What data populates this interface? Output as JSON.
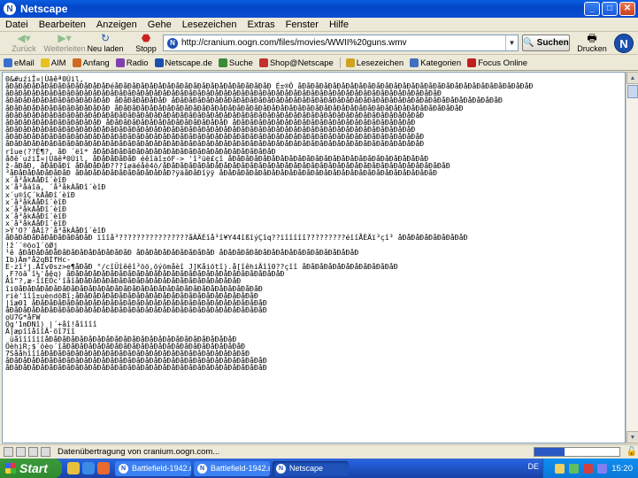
{
  "window": {
    "title": "Netscape"
  },
  "menu": [
    "Datei",
    "Bearbeiten",
    "Anzeigen",
    "Gehe",
    "Lesezeichen",
    "Extras",
    "Fenster",
    "Hilfe"
  ],
  "nav": {
    "back": "Zurück",
    "forward": "Weiterleiten",
    "reload": "Neu laden",
    "stop": "Stopp",
    "url": "http://cranium.oogn.com/files/movies/WWII%20guns.wmv",
    "search": "Suchen",
    "print": "Drucken"
  },
  "personal_toolbar": [
    {
      "label": "eMail",
      "color": "#3a6fd0"
    },
    {
      "label": "AIM",
      "color": "#e8c020"
    },
    {
      "label": "Anfang",
      "color": "#d06a20"
    },
    {
      "label": "Radio",
      "color": "#8040b0"
    },
    {
      "label": "Netscape.de",
      "color": "#1b4fae"
    },
    {
      "label": "Suche",
      "color": "#3a8a3a"
    },
    {
      "label": "Shop@Netscape",
      "color": "#c23030"
    },
    {
      "label": "Lesezeichen",
      "color": "#d0a020"
    },
    {
      "label": "Kategorien",
      "color": "#4070c0"
    },
    {
      "label": "Focus Online",
      "color": "#c02020"
    }
  ],
  "content_lines": [
    "0&#uźiÎ¤|Ùãêª0Ùil,",
    "åÐåÐåÐåÐåÐåÐåÐåÐåÐåÐåÐåÐéåÐåÐåÐåÐåÐåÐåÐåÐåÐåÐåÐåÐåÐåÐåÐåÐåÐåÐ É±®Ô åÐåÐåÐåÐåÐåÐåÐåÐåÐåÐåÐåÐåÐåÐåÐåÐåÐåÐåÐåÐåÐåÐåÐåÐåÐåÐåÐ",
    "åÐåÐåÐåÐåÐåÐåÐåÐåÐåÐåÐåÐåÐåÐåÐåÐåÐåÐåÐåÐåÐåÐåÐåÐåÐåÐåÐåÐåÐåÐåÐåÐåÐåÐåÐåÐåÐåÐåÐåÐåÐåÐåÐåÐåÐåÐåÐåÐåÐåÐ",
    "åÐåÐåÐåÐåÐåÐåÐåÐåÐåÐåÐåÐ åÐåÐåÐåÐåÐåÐ åÐåÐåÐåÐåÐåÐåÐåÐåÐåÐåÐåÐåÐåÐåÐåÐåÐåÐåÐåÐåÐåÐåÐåÐåÐåÐåÐåÐåÐåÐåÐåÐåÐåÐåÐåÐåÐåÐ",
    "åÐåÐåÐåÐåÐåÐåÐåÐåÐåÐåÐåÐ åÐåÐåÐåÐåÐåÐåÐåÐåÐåÐåÐåÐåÐåÐåÐåÐåÐåÐåÐåÐåÐåÐåÐåÐåÐåÐåÐåÐåÐåÐåÐåÐåÐåÐåÐåÐåÐåÐåÐåÐ",
    "åÐåÐåÐåÐåÐåÐåÐåÐåÐåÐåÐåÐåÐåÐåÐåÐåÐåÐåÐåÐåÐåÐåÐåÐåÐåÐåÐåÐåÐåÐåÐåÐåÐåÐåÐåÐåÐåÐåÐåÐåÐåÐåÐåÐåÐåÐåÐåÐ",
    "åÐåÐåÐåÐåÐåÐåÐåÐåÐåÐåÐ åÐåÐåÐåÐåÐåÐåÐåÐåÐåÐåÐåÐåÐåÐ åÐåÐåÐåÐåÐåÐåÐåÐåÐåÐåÐåÐåÐåÐåÐåÐåÐåÐåÐåÐåÐ",
    "åÐåÐåÐåÐåÐåÐåÐåÐåÐåÐåÐåÐåÐåÐåÐåÐåÐåÐåÐåÐåÐåÐåÐåÐåÐåÐåÐåÐåÐåÐåÐåÐåÐåÐåÐåÐåÐåÐåÐåÐåÐåÐåÐåÐåÐåÐåÐ",
    "åÐåÐåÐåÐåÐåÐåÐåÐåÐåÐåÐåÐåÐåÐåÐåÐåÐåÐåÐåÐåÐåÐåÐåÐåÐåÐåÐåÐåÐåÐåÐåÐåÐåÐåÐåÐåÐåÐåÐåÐåÐåÐåÐåÐåÐåÐåÐåÐ",
    "åÐåÐåÐåÐåÐåÐåÐåÐåÐåÐåÐåÐåÐåÐåÐåÐåÐåÐåÐåÐåÐåÐåÐåÐåÐåÐåÐåÐåÐåÐåÐåÐåÐåÐåÐåÐåÐåÐåÐåÐåÐåÐåÐåÐåÐåÐåÐåÐ",
    "rîue(??É¶?, åÐ ´ëî* åÐåÐåÐåÐåÐåÐåÐåÐåÐåÐåÐåÐåÐåÐåÐåÐåÐåÐåÐåÐåÐ",
    "åðê´uźiÎ¤|Ùãêª0Ùil, åÐåÐåÐåÐåÐ éêîäî±õF-> 'î³üë£çî åÐåÐåÐåÐåÐåÐåÐåÐåÐåÐåÐåÐåÐåÐåÐåÐåÐåÐåÐåÐåÐåÐåÐ",
    "ž-åÐåÐ, åÐåÐåÐî åÐåÐåÐåÐ???îøäéåê4ö/åÐåÐåÐåÐåÐåÐåÐåÐåÐåÐåÐåÐåÐåÐåÐåÐåÐåÐåÐåÐåÐåÐåÐåÐåÐåÐåÐåÐåÐåÐåÐåÐåÐ",
    "³åÐåÐåÐåÐåÐåÐåÐ åÐåÐåÐåÐåÐåÐåÐåÐåÐåÐåÐ?ÿäåÐåÐîÿÿ åÐåÐåÐåÐåÐåÐåÐåÐåÐåÐåÐåÐåÐåÐåÐåÐåÐåÐåÐåÐåÐåÐåÐåÐåÐ",
    "x´å³åkÀåÐî´èîÐ",
    "x´å³åáîä, ´å³åkÀåÐî´èîÐ",
    "x´u®îÇ´kÀåÐî´èîÐ",
    "x´å³åkÀåÐî´èîÐ",
    "x´å³åkÀåÐî´èîÐ",
    "x´å³åkÀåÐî´èîÐ",
    "x´å³åkÀåÐî´èîÐ",
    ">Ý'O?´åÀî?´å³åkÀåÐî´èîÐ",
    "åÐåÐåÐåÐåÐåÐåÐåÐåÐåÐ ïîîå³????????????????åÀÄÈîå³î¥Y44îßîýÇîq??ïîîîîî?????????éîîÅÈÄï³çî³ åÐåÐåÐåÐåÐåÐåÐåÐ",
    "!ž´´®öo1´öØj",
    "¹ê åÐåÐåÐåÐåÐåÐåÐåÐåÐåÐåÐåÐåÐ åÐåÐåÐåÐåÐåÐåÐåÐåÐ åÐåÐåÐåÐåÐåÐåÐåÐåÐåÐåÐåÐåÐåÐåÐåÐ",
    "Ib)Äm°å2qBIfHc-",
    "E·zî²j.ÄIv0sz>e¶åÐåÐ °/cîÜîêêî³öö,öýömåèî J]Kåiõtî).å[îêhiÄîî0??çîî åÐåÐåÐåÐåÐåÐåÐåÐåÐåÐåÐ",
    ",F?öâ´î¼'åêq) åÐåÐåÐåÐåÐåÐåÐåÐåÐåÐåÐåÐåÐåÐåÐåÐåÐåÐåÐåÐåÐåÐåÐåÐåÐ",
    "Âî\"?,æ·îîÉÖc'îåîåÐåÐåÐåÐåÐåÐåÐåÐåÐåÐåÐåÐåÐåÐåÐåÐåÐåÐåÐ",
    "îi0åÐåÐåÐåÐåÐåÐåÐåÐåÐåÐåÐåÐåÐåÐåÐåÐåÐåÐåÐåÐåÐåÐåÐåÐåÐåÐåÐåÐ",
    "riè'îîî±uèndõBî;åÐåÐåÐåÐåÐåÐåÐåÐåÐåÐåÐåÐåÐåÐåÐåÐåÐåÐåÐåÐåÐ",
    "|îæ01 åÐåÐåÐåÐåÐåÐåÐåÐåÐåÐåÐåÐåÐåÐåÐåÐåÐåÐåÐåÐåÐåÐåÐåÐåÐåÐåÐ",
    "åÐåÐåÐåÐåÐåÐåÐåÐåÐåÐåÐåÐåÐåÐåÐåÐåÐåÐåÐåÐåÐåÐåÐåÐåÐåÐåÐåÐåÐåÐ",
    "oU7G*åFW",
    "Ög'1mDNî) |´+åî!åîîîî",
    "Ä|æpîîåîîÄ·öî7îî",
    " üåîîîîîîåÐåÐåÐåÐåÐåÐåÐåÐåÐåÐåÐåÐåÐåÐåÐåÐåÐåÐåÐåÐåÐåÐ",
    "ÖèhiR;$´öèo´îåÐåÐåÐåÐåÐåÐåÐåÐåÐåÐåÐåÐåÐåÐåÐåÐåÐåÐåÐåÐåÐ",
    "7SååhîîîåÐåÐåÐåÐåÐåÐåÐåÐåÐåÐåÐåÐåÐåÐåÐåÐåÐåÐåÐåÐåÐåÐåÐåÐ",
    "åÐåÐåÐåÐåÐåÐåÐåÐåÐåÐåÐåÐåÐåÐåÐåÐåÐåÐåÐåÐåÐåÐåÐåÐåÐåÐåÐåÐåÐåÐ",
    "åÐåÐåÐåÐåÐåÐåÐåÐåÐåÐåÐåÐåÐåÐåÐåÐåÐåÐåÐåÐåÐåÐåÐåÐåÐåÐåÐåÐåÐåÐ"
  ],
  "status": {
    "text": "Datenübertragung von cranium.oogn.com...",
    "progress": 0.35
  },
  "taskbar": {
    "start": "Start",
    "tasks": [
      {
        "label": "Battlefield-1942.net ...",
        "active": false
      },
      {
        "label": "Battlefield-1942.net ...",
        "active": false
      },
      {
        "label": "Netscape",
        "active": true
      }
    ],
    "lang": "DE",
    "clock": "15:20"
  }
}
